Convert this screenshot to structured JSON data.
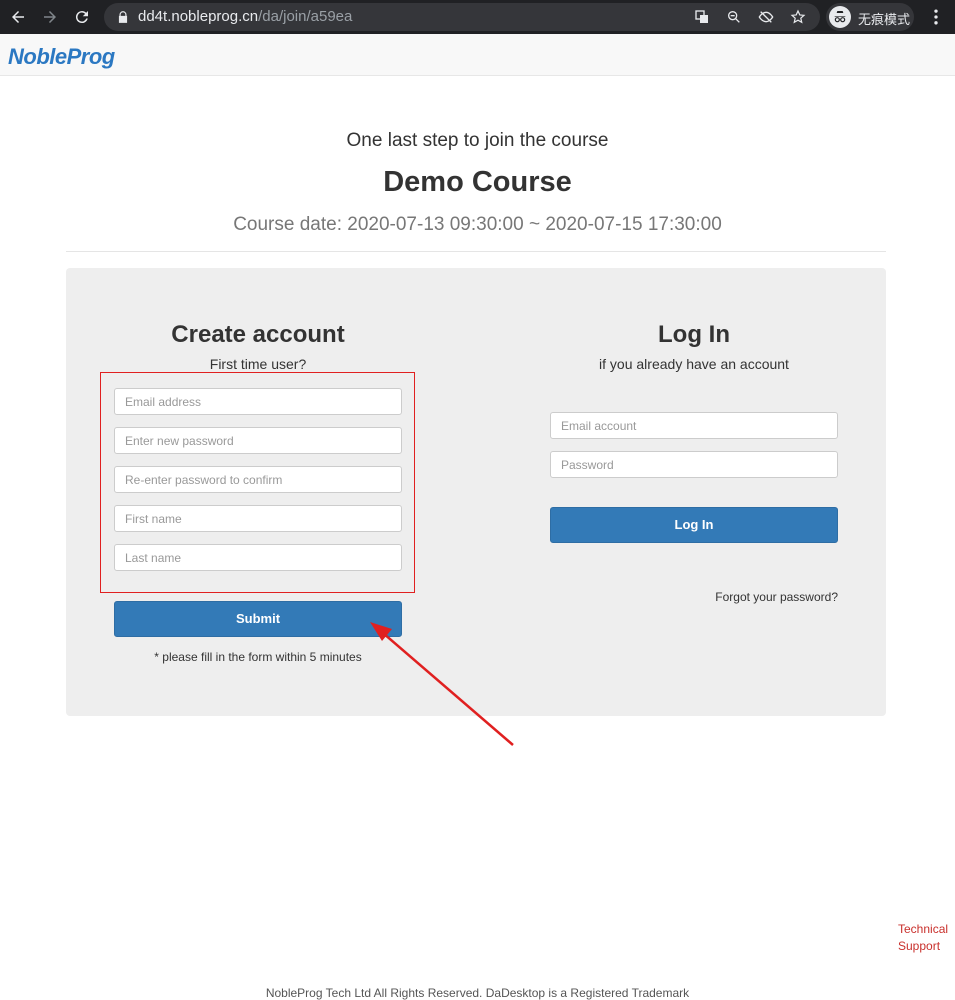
{
  "browser": {
    "url_host": "dd4t.nobleprog.cn",
    "url_path": "/da/join/a59ea",
    "incognito_label": "无痕模式"
  },
  "header": {
    "brand": "NobleProg"
  },
  "intro": {
    "step_text": "One last step to join the course",
    "course_title": "Demo Course",
    "course_date": "Course date: 2020-07-13 09:30:00 ~ 2020-07-15 17:30:00"
  },
  "create_account": {
    "title": "Create account",
    "subtitle": "First time user?",
    "email_placeholder": "Email address",
    "password_placeholder": "Enter new password",
    "confirm_placeholder": "Re-enter password to confirm",
    "first_name_placeholder": "First name",
    "last_name_placeholder": "Last name",
    "submit_label": "Submit",
    "note": "* please fill in the form within 5 minutes"
  },
  "login": {
    "title": "Log In",
    "subtitle": "if you already have an account",
    "email_placeholder": "Email account",
    "password_placeholder": "Password",
    "login_label": "Log In",
    "forgot_label": "Forgot your password?"
  },
  "support": {
    "line1": "Technical",
    "line2": "Support"
  },
  "footer": {
    "text": "NobleProg Tech Ltd All Rights Reserved. DaDesktop is a Registered Trademark"
  },
  "colors": {
    "accent": "#337ab7",
    "brand": "#2b78c2",
    "highlight": "#e02020",
    "support": "#c9302c"
  }
}
